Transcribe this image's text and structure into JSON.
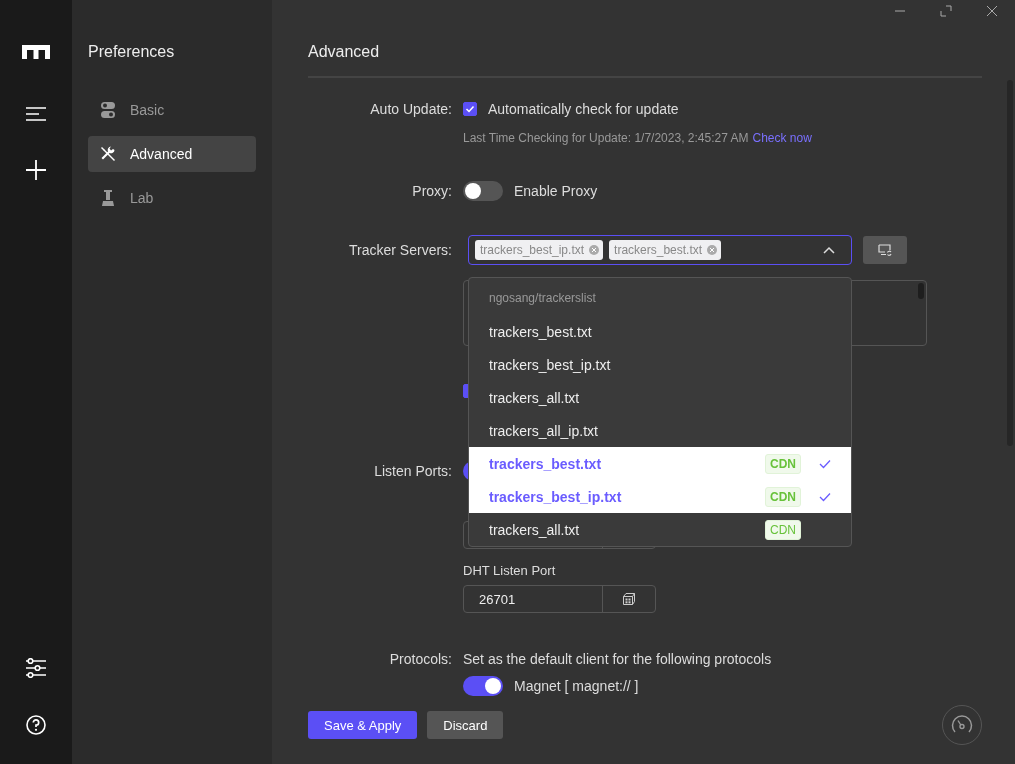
{
  "sidebar": {
    "title": "Preferences",
    "items": [
      {
        "label": "Basic",
        "selected": false
      },
      {
        "label": "Advanced",
        "selected": true
      },
      {
        "label": "Lab",
        "selected": false
      }
    ]
  },
  "page_title": "Advanced",
  "auto_update": {
    "label": "Auto Update:",
    "checkbox": {
      "label": "Automatically check for update",
      "checked": true
    },
    "last_check": "Last Time Checking for Update: 1/7/2023, 2:45:27 AM",
    "check_now": "Check now"
  },
  "proxy": {
    "label": "Proxy:",
    "toggle": {
      "label": "Enable Proxy",
      "on": false
    }
  },
  "tracker_servers": {
    "label": "Tracker Servers:",
    "tags": [
      "trackers_best_ip.txt",
      "trackers_best.txt"
    ],
    "expanded": true,
    "group": "ngosang/trackerslist",
    "options": [
      {
        "label": "trackers_best.txt",
        "selected": false
      },
      {
        "label": "trackers_best_ip.txt",
        "selected": false
      },
      {
        "label": "trackers_all.txt",
        "selected": false
      },
      {
        "label": "trackers_all_ip.txt",
        "selected": false
      },
      {
        "label": "trackers_best.txt",
        "badge": "CDN",
        "selected": true
      },
      {
        "label": "trackers_best_ip.txt",
        "badge": "CDN",
        "selected": true
      },
      {
        "label": "trackers_all.txt",
        "badge": "CDN",
        "selected": false
      }
    ]
  },
  "auto_sync": {
    "checked": true
  },
  "listen_ports": {
    "label": "Listen Ports:",
    "on": true
  },
  "dht": {
    "label": "DHT Listen Port",
    "value": "26701"
  },
  "protocols": {
    "label": "Protocols:",
    "description": "Set as the default client for the following protocols",
    "items": [
      {
        "label": "Magnet [ magnet:// ]",
        "on": true
      }
    ]
  },
  "buttons": {
    "save": "Save & Apply",
    "discard": "Discard"
  }
}
